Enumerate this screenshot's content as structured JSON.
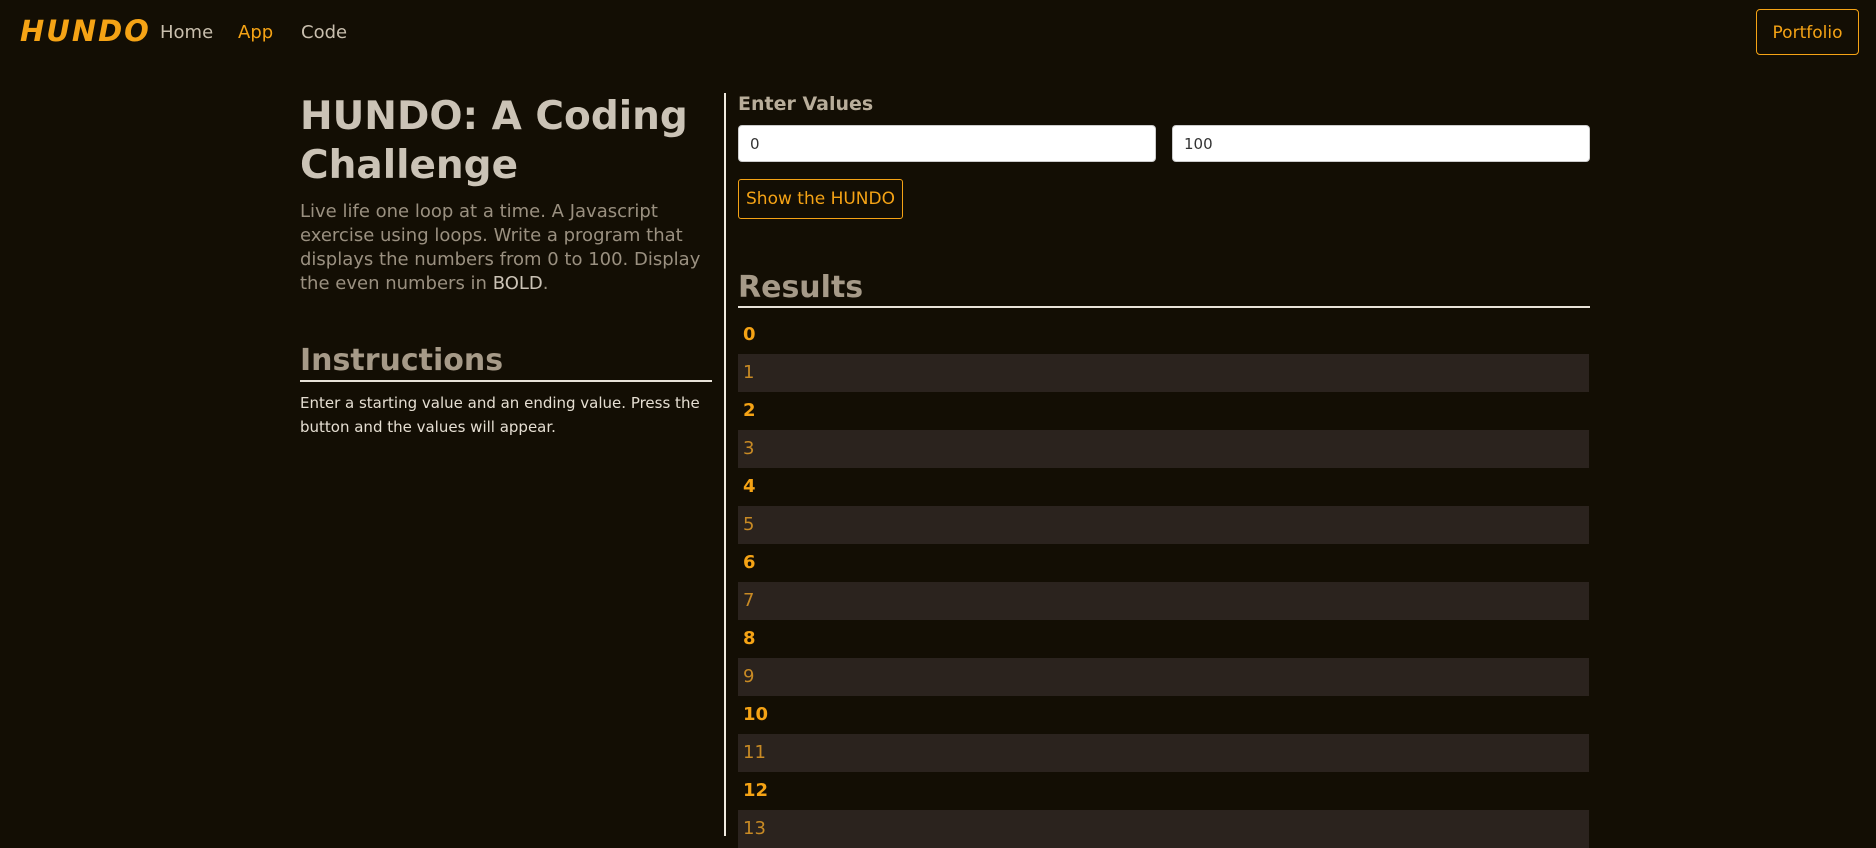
{
  "nav": {
    "brand": "HUNDO",
    "links": [
      "Home",
      "App",
      "Code"
    ],
    "active": "App",
    "portfolio_label": "Portfolio"
  },
  "intro": {
    "title": "HUNDO: A Coding Challenge",
    "lead": "Live life one loop at a time. A Javascript exercise using loops. Write a program that displays the numbers from 0 to 100. Display the even numbers in ",
    "lead_emphasis": "BOLD",
    "lead_end": "."
  },
  "instructions": {
    "title": "Instructions",
    "text": "Enter a starting value and an ending value. Press the button and the values will appear."
  },
  "form": {
    "label": "Enter Values",
    "start_value": "0",
    "end_value": "100",
    "button_label": "Show the HUNDO"
  },
  "results": {
    "title": "Results",
    "values": [
      "0",
      "1",
      "2",
      "3",
      "4",
      "5",
      "6",
      "7",
      "8",
      "9",
      "10",
      "11",
      "12",
      "13"
    ]
  },
  "colors": {
    "accent": "#f5a315",
    "background": "#130e04",
    "odd_row": "#2b231e"
  }
}
